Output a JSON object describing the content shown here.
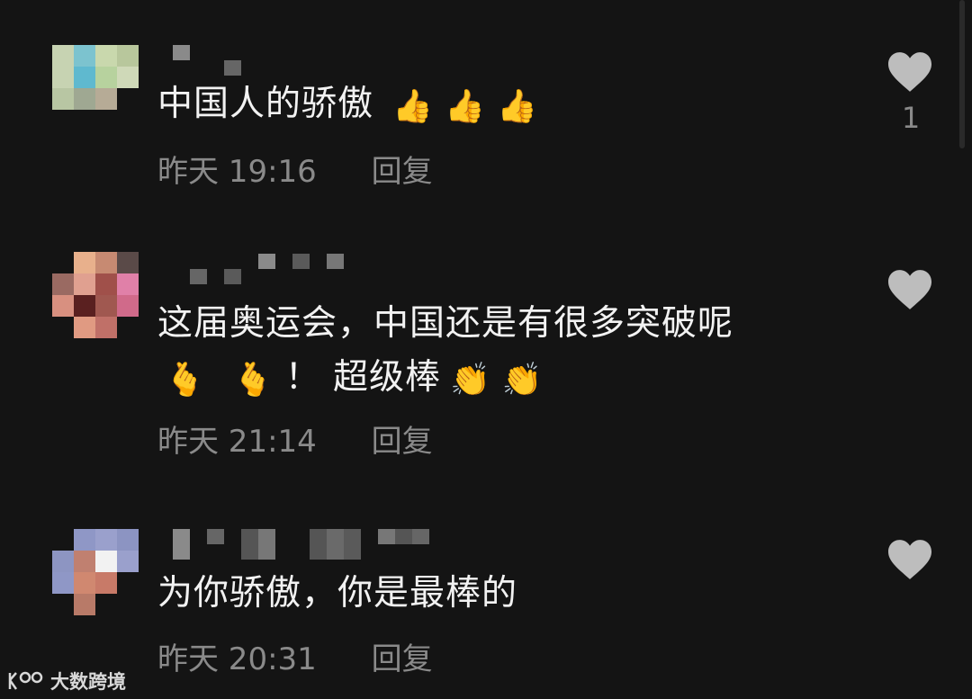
{
  "comments": [
    {
      "text": "中国人的骄傲",
      "emojis": [
        "👍",
        "👍",
        "👍"
      ],
      "time": "昨天 19:16",
      "reply_label": "回复",
      "likes": "1"
    },
    {
      "text_line1": "这届奥运会，中国还是有很多突破呢",
      "emoji_a": [
        "🫰",
        "🫰"
      ],
      "text_line2": "！ 超级棒",
      "emoji_b": [
        "👏",
        "👏"
      ],
      "time": "昨天 21:14",
      "reply_label": "回复"
    },
    {
      "text": "为你骄傲，你是最棒的",
      "time": "昨天 20:31",
      "reply_label": "回复"
    }
  ],
  "watermark": {
    "text": "大数跨境"
  },
  "icons": {
    "like": "heart-icon",
    "logo": "brand-logo-icon"
  },
  "colors": {
    "background": "#141414",
    "text": "#f2f2f2",
    "muted": "#8a8a8a",
    "heart": "#bdbdbd"
  }
}
